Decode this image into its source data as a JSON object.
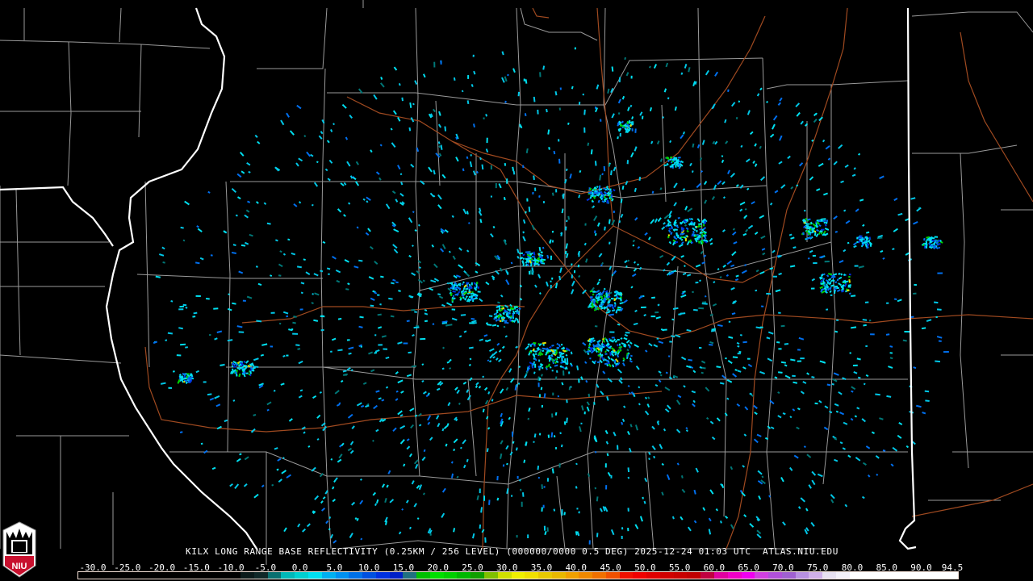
{
  "title": "KILX LONG RANGE BASE REFLECTIVITY (0.25KM / 256 LEVEL) (000000/0000 0.5 DEG) 2025-12-24 01:03 UTC  ATLAS.NIU.EDU",
  "logo": {
    "text": "NIU",
    "icon": "niu-logo-icon"
  },
  "colorbar": {
    "labels": [
      "-30.0",
      "-25.0",
      "-20.0",
      "-15.0",
      "-10.0",
      "-5.0",
      "0.0",
      "5.0",
      "10.0",
      "15.0",
      "20.0",
      "25.0",
      "30.0",
      "35.0",
      "40.0",
      "45.0",
      "50.0",
      "55.0",
      "60.0",
      "65.0",
      "70.0",
      "75.0",
      "80.0",
      "85.0",
      "90.0",
      "94.5"
    ],
    "min": -30,
    "max": 94.5,
    "colors": [
      "#000000",
      "#000000",
      "#000000",
      "#000000",
      "#000000",
      "#000000",
      "#000000",
      "#000000",
      "#000000",
      "#000000",
      "#000000",
      "#000000",
      "#0a1a1a",
      "#102828",
      "#0a7070",
      "#00b8b8",
      "#00d0d0",
      "#00e0f0",
      "#00b0f0",
      "#0090f0",
      "#0070e8",
      "#0050e0",
      "#0030e0",
      "#0020c8",
      "#207080",
      "#00c000",
      "#00e000",
      "#00d000",
      "#00b800",
      "#10a000",
      "#80c000",
      "#d0e000",
      "#f0f000",
      "#f0e000",
      "#e8c800",
      "#e8b800",
      "#f0a000",
      "#f08800",
      "#f07000",
      "#f05000",
      "#f01000",
      "#f00000",
      "#e00000",
      "#d00000",
      "#c80000",
      "#c00000",
      "#c00040",
      "#e000a0",
      "#f000c8",
      "#f000f0",
      "#d040e0",
      "#b050d8",
      "#a060d0",
      "#b890e0",
      "#d0b0e8",
      "#e8e0f0",
      "#f4f0f8",
      "#ffffff",
      "#ffffff",
      "#ffffff",
      "#ffffff",
      "#ffffff",
      "#ffffff",
      "#ffffff",
      "#ffffff"
    ]
  },
  "radar": {
    "site": "KILX",
    "colors": {
      "light": "#00c8e8",
      "cyan": "#00e0f0",
      "blue": "#0070f0",
      "dark": "#0030e0",
      "teal": "#007878",
      "green": "#00d000",
      "yellow": "#e0e000"
    }
  },
  "map_colors": {
    "state": "#ffffff",
    "county": "#9a9a9a",
    "road": "#a04a20"
  }
}
